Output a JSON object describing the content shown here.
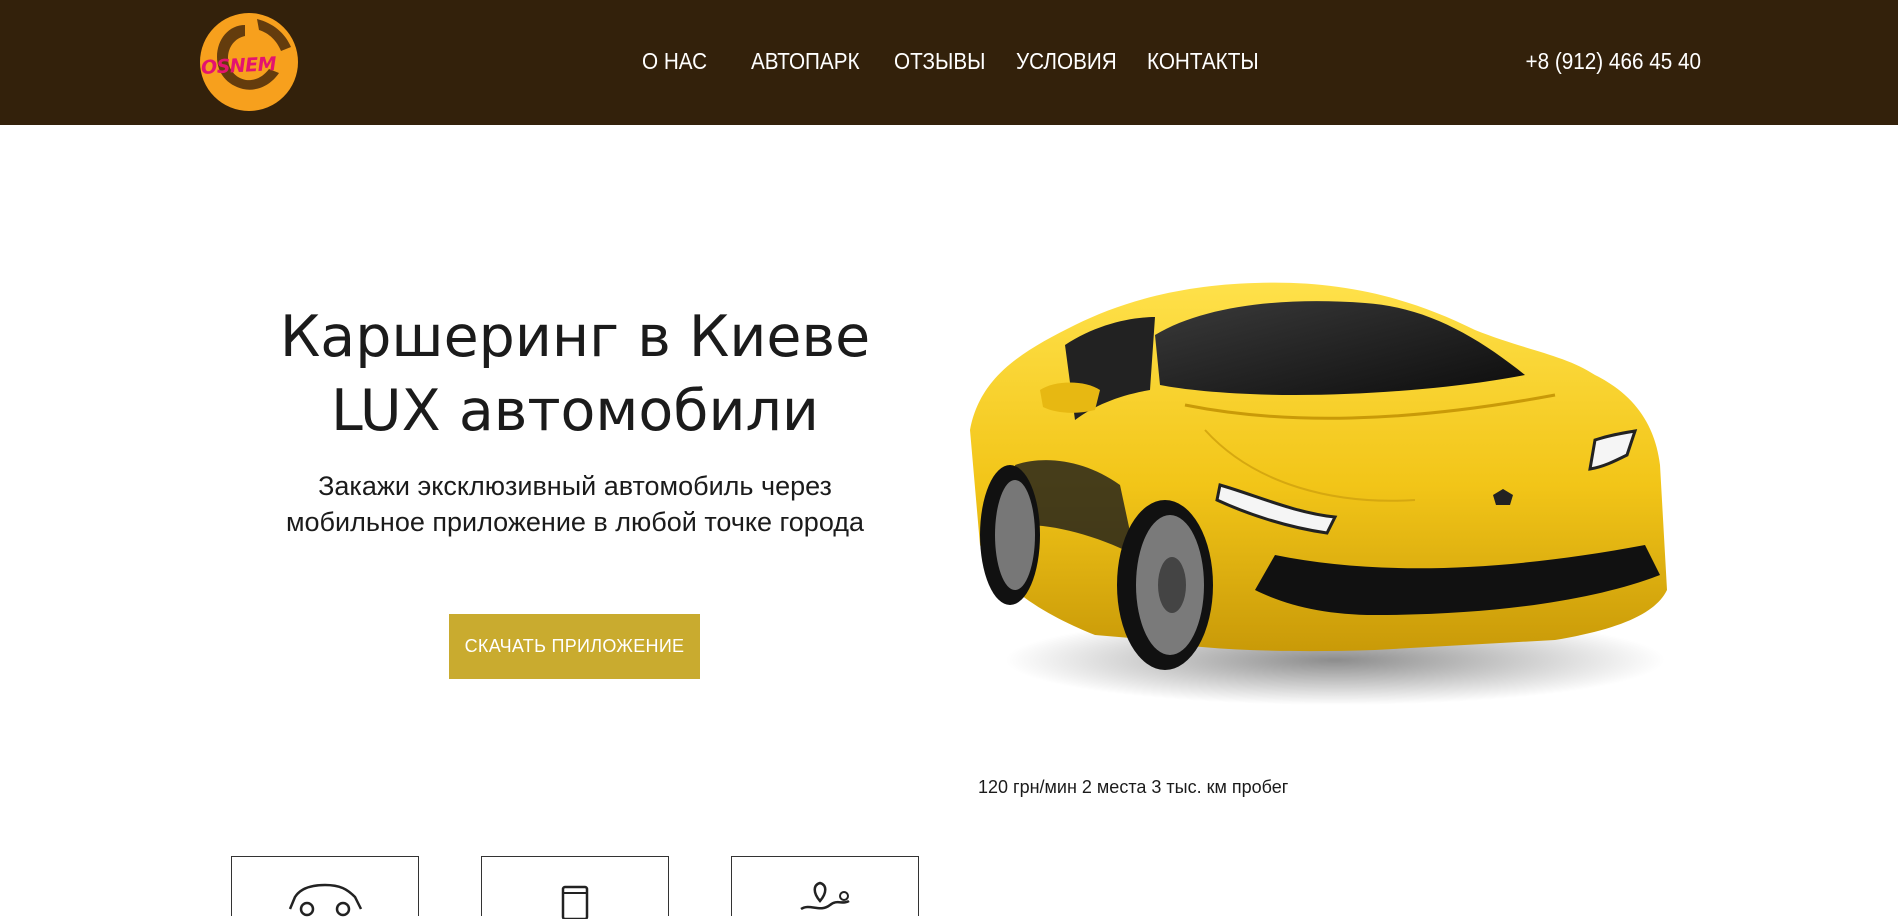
{
  "brand": {
    "logo_text": "OSNEM",
    "logo_icon": "orange-circle-logo"
  },
  "nav": {
    "items": [
      {
        "label": "О НАС"
      },
      {
        "label": "АВТОПАРК"
      },
      {
        "label": "ОТЗЫВЫ"
      },
      {
        "label": "УСЛОВИЯ"
      },
      {
        "label": "КОНТАКТЫ"
      }
    ]
  },
  "header": {
    "phone": "+8 (912) 466 45 40"
  },
  "hero": {
    "title_line1": "Каршеринг в Киеве",
    "title_line2": "LUX автомобили",
    "subtitle_line1": "Закажи эксклюзивный автомобиль через",
    "subtitle_line2": "мобильное приложение в любой точке города",
    "cta_label": "СКАЧАТЬ ПРИЛОЖЕНИЕ"
  },
  "car": {
    "image": "yellow-sports-car",
    "specs": "120 грн/мин 2 места 3 тыс. км пробег"
  },
  "features": [
    {
      "icon": "car-icon"
    },
    {
      "icon": "phone-icon"
    },
    {
      "icon": "map-route-icon"
    }
  ],
  "colors": {
    "header_bg": "#33210b",
    "accent": "#c9ab2f",
    "logo_orange": "#f7a01d",
    "logo_pink": "#e4136f",
    "car_yellow": "#f2c518"
  }
}
